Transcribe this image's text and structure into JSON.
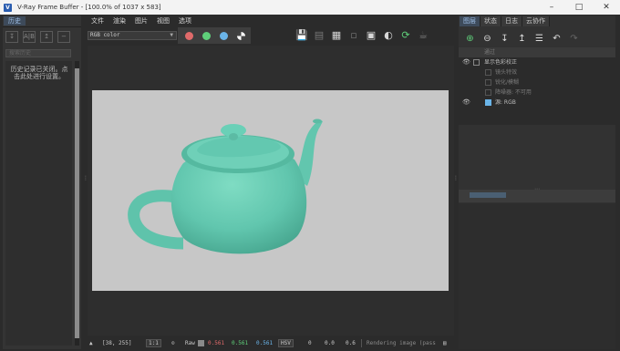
{
  "window": {
    "title": "V-Ray Frame Buffer - [100.0% of 1037 x 583]",
    "icon_letter": "V",
    "controls": [
      "minimize-icon",
      "maximize-icon",
      "close-icon"
    ]
  },
  "history_panel": {
    "tab_label": "历史",
    "toolbar_icons": [
      "save-history-icon",
      "compare-ab-icon",
      "load-history-icon",
      "remove-history-icon"
    ],
    "search_placeholder": "搜索历史",
    "notice": "历史记录已关闭。点击此处进行设置。"
  },
  "menu": [
    "文件",
    "渲染",
    "图片",
    "视图",
    "选项"
  ],
  "toolbar": {
    "channel": "RGB color",
    "color_buttons": [
      {
        "name": "red-channel",
        "color": "#e06a6a"
      },
      {
        "name": "green-channel",
        "color": "#5fd07a"
      },
      {
        "name": "blue-channel",
        "color": "#6ab4e8"
      }
    ],
    "right_icons": [
      "save-icon",
      "clear-icon",
      "region-render-icon",
      "link-icon",
      "zoom-icon",
      "track-mouse-icon",
      "refresh-icon",
      "teapot-render-icon"
    ]
  },
  "render": {
    "background": "#c7c7c7",
    "teapot_color": "#61c6ae"
  },
  "statusbar": {
    "coords": "[38, 255]",
    "zoom": "1:1",
    "raw_label": "Raw",
    "r_value": "0.561",
    "g_value": "0.561",
    "b_value": "0.561",
    "mode": "HSV",
    "h_value": "0",
    "s_value": "0.0",
    "v_value": "0.6",
    "status": "Rendering image (pass"
  },
  "right_panel": {
    "tabs": [
      "图层",
      "状态",
      "日志",
      "云协作"
    ],
    "active_tab": 0,
    "toolbar_icons": [
      "create-layer-icon",
      "delete-layer-icon",
      "save-layer-icon",
      "load-layer-icon",
      "list-icon",
      "undo-icon",
      "redo-icon"
    ],
    "layers": [
      {
        "label": "通过",
        "visible": false,
        "dim": true,
        "indent": 1
      },
      {
        "label": "显示色彩校正",
        "visible": true,
        "dim": false,
        "indent": 1
      },
      {
        "label": "镜头特效",
        "visible": false,
        "dim": true,
        "indent": 2
      },
      {
        "label": "锐化/模糊",
        "visible": false,
        "dim": true,
        "indent": 2
      },
      {
        "label": "降噪器: 不可用",
        "visible": false,
        "dim": true,
        "indent": 2
      },
      {
        "label": "源: RGB",
        "visible": true,
        "dim": false,
        "indent": 2
      }
    ]
  }
}
